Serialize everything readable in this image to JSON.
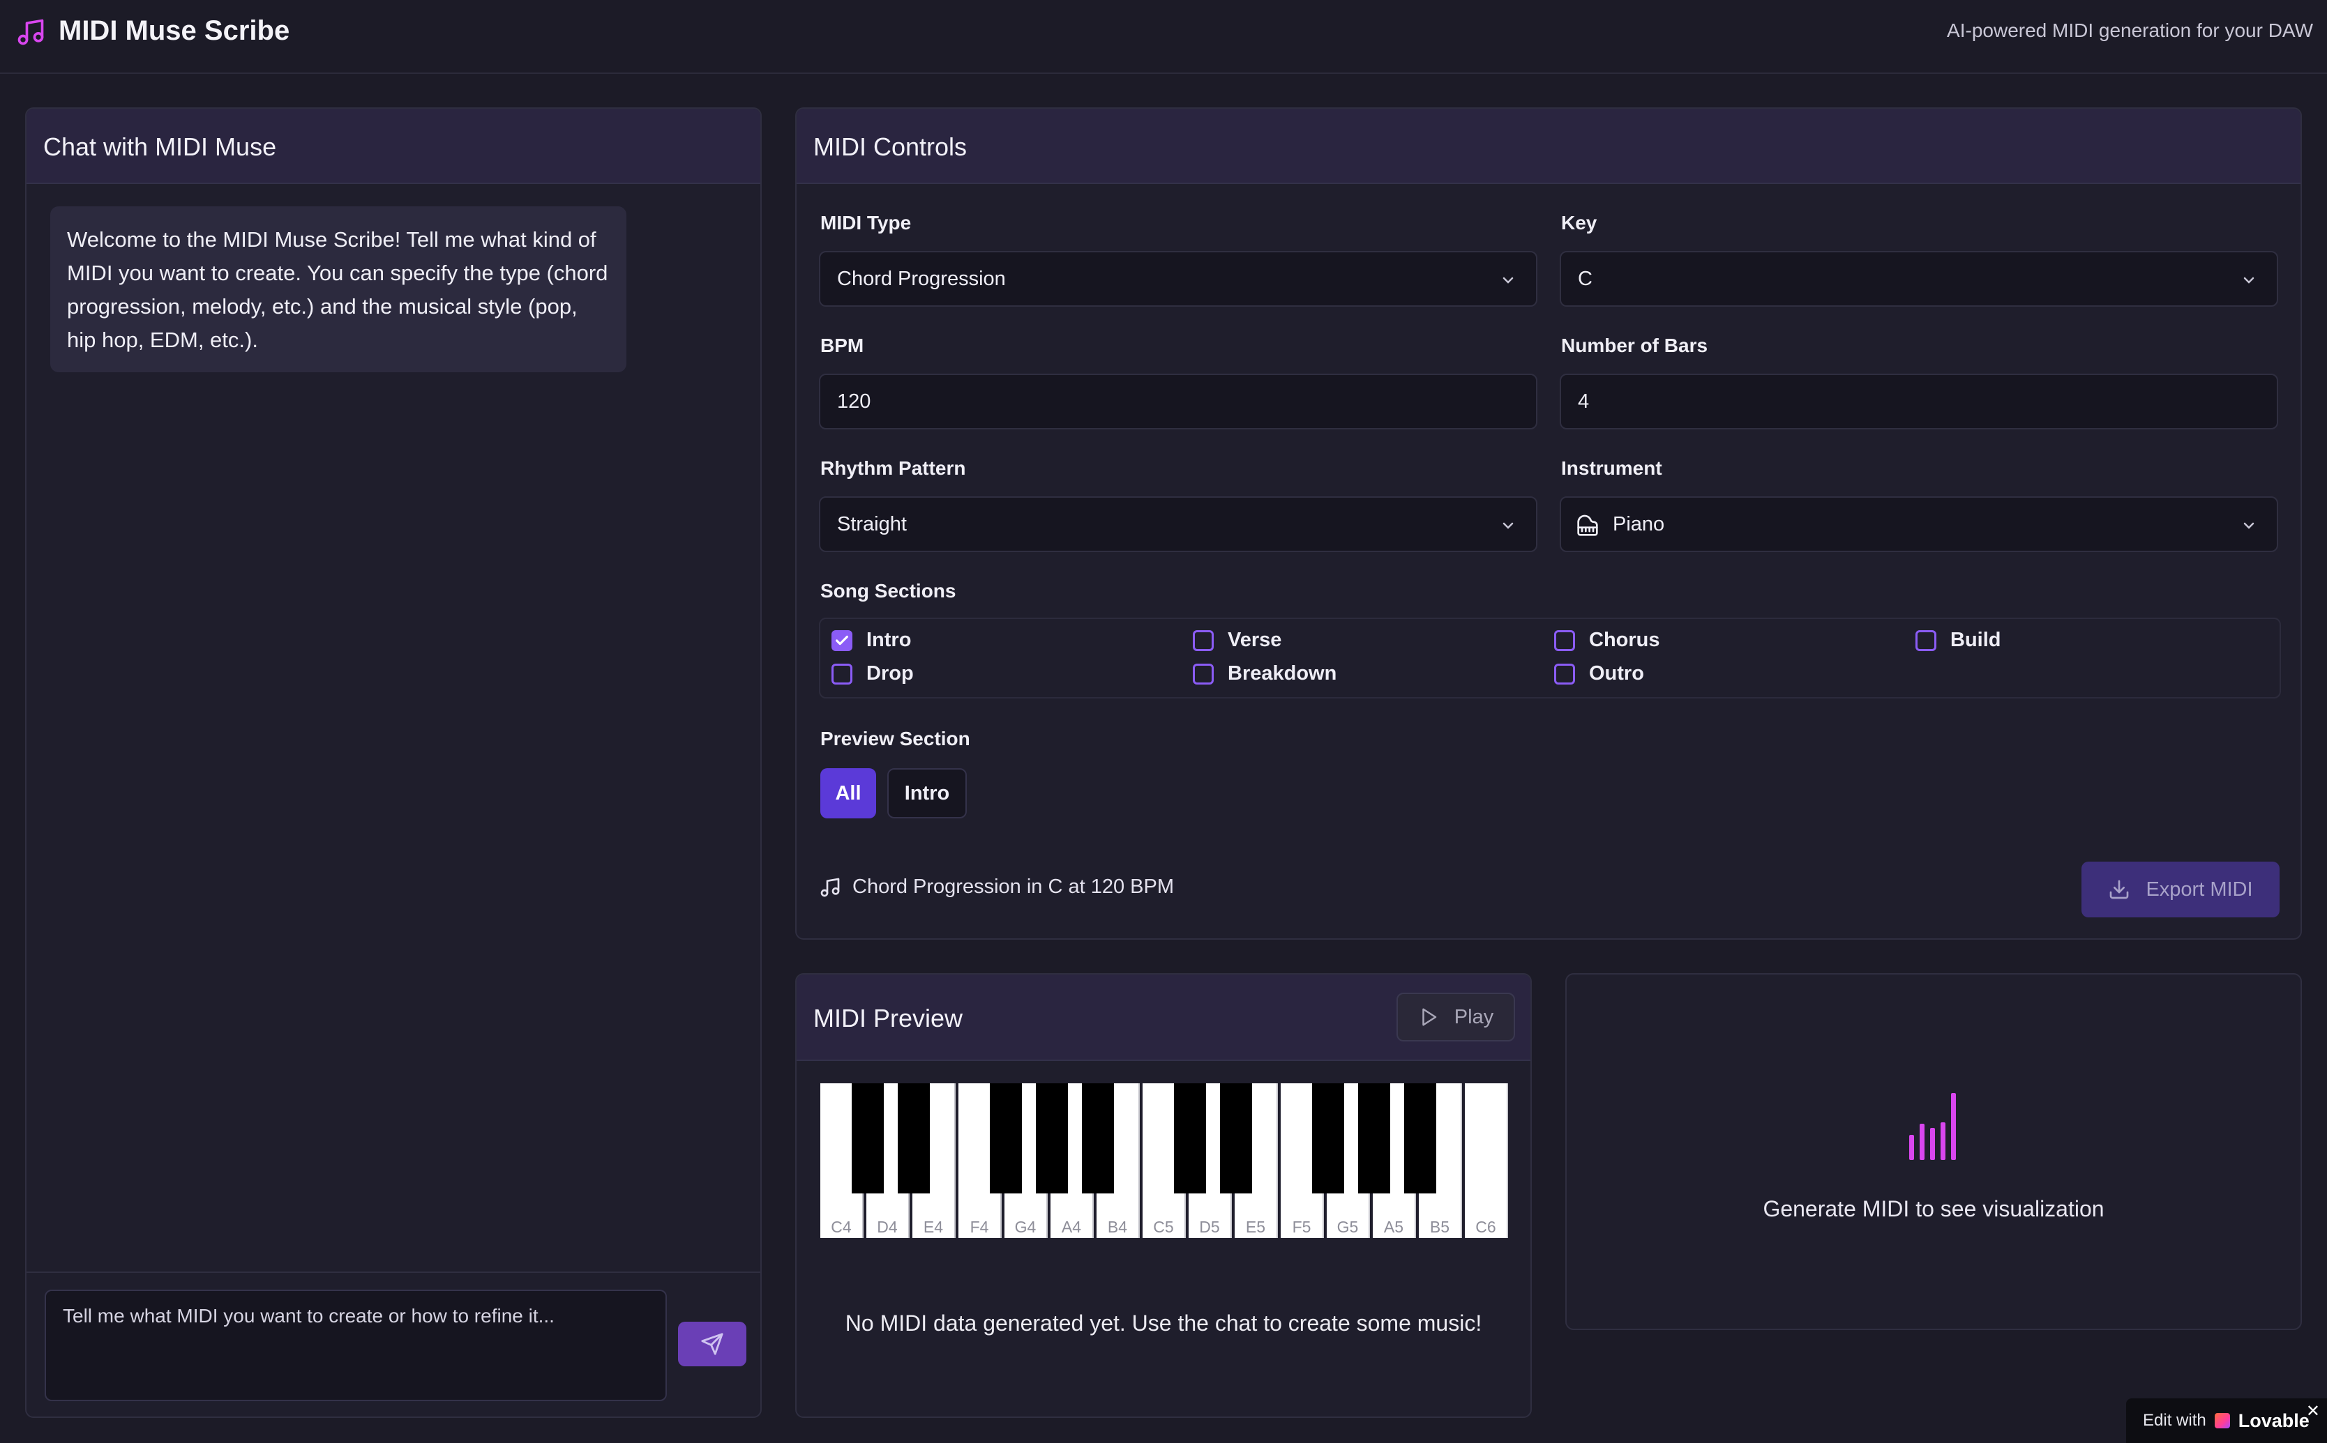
{
  "header": {
    "title": "MIDI Muse Scribe",
    "tagline": "AI-powered MIDI generation for your DAW"
  },
  "chat": {
    "title": "Chat with MIDI Muse",
    "welcome": "Welcome to the MIDI Muse Scribe! Tell me what kind of MIDI you want to create. You can specify the type (chord progression, melody, etc.) and the musical style (pop, hip hop, EDM, etc.).",
    "input_placeholder": "Tell me what MIDI you want to create or how to refine it..."
  },
  "controls": {
    "title": "MIDI Controls",
    "midi_type": {
      "label": "MIDI Type",
      "value": "Chord Progression"
    },
    "key": {
      "label": "Key",
      "value": "C"
    },
    "bpm": {
      "label": "BPM",
      "value": "120"
    },
    "bars": {
      "label": "Number of Bars",
      "value": "4"
    },
    "rhythm": {
      "label": "Rhythm Pattern",
      "value": "Straight"
    },
    "instrument": {
      "label": "Instrument",
      "value": "Piano"
    },
    "sections": {
      "label": "Song Sections",
      "items": [
        {
          "label": "Intro",
          "checked": true
        },
        {
          "label": "Verse",
          "checked": false
        },
        {
          "label": "Chorus",
          "checked": false
        },
        {
          "label": "Build",
          "checked": false
        },
        {
          "label": "Drop",
          "checked": false
        },
        {
          "label": "Breakdown",
          "checked": false
        },
        {
          "label": "Outro",
          "checked": false
        }
      ]
    },
    "preview_section": {
      "label": "Preview Section",
      "options": [
        "All",
        "Intro"
      ],
      "selected": "All"
    },
    "summary": "Chord Progression in C at 120 BPM",
    "export_label": "Export MIDI"
  },
  "preview": {
    "title": "MIDI Preview",
    "play_label": "Play",
    "white_keys": [
      "C4",
      "D4",
      "E4",
      "F4",
      "G4",
      "A4",
      "B4",
      "C5",
      "D5",
      "E5",
      "F5",
      "G5",
      "A5",
      "B5",
      "C6"
    ],
    "empty_text": "No MIDI data generated yet. Use the chat to create some music!"
  },
  "visualization": {
    "text": "Generate MIDI to see visualization"
  },
  "badge": {
    "prefix": "Edit with",
    "brand": "Lovable",
    "close": "✕"
  },
  "colors": {
    "accent": "#8b5cf6",
    "accent_strong": "#5b3ad8",
    "viz_pink": "#d946ef",
    "background": "#1c1b27"
  }
}
